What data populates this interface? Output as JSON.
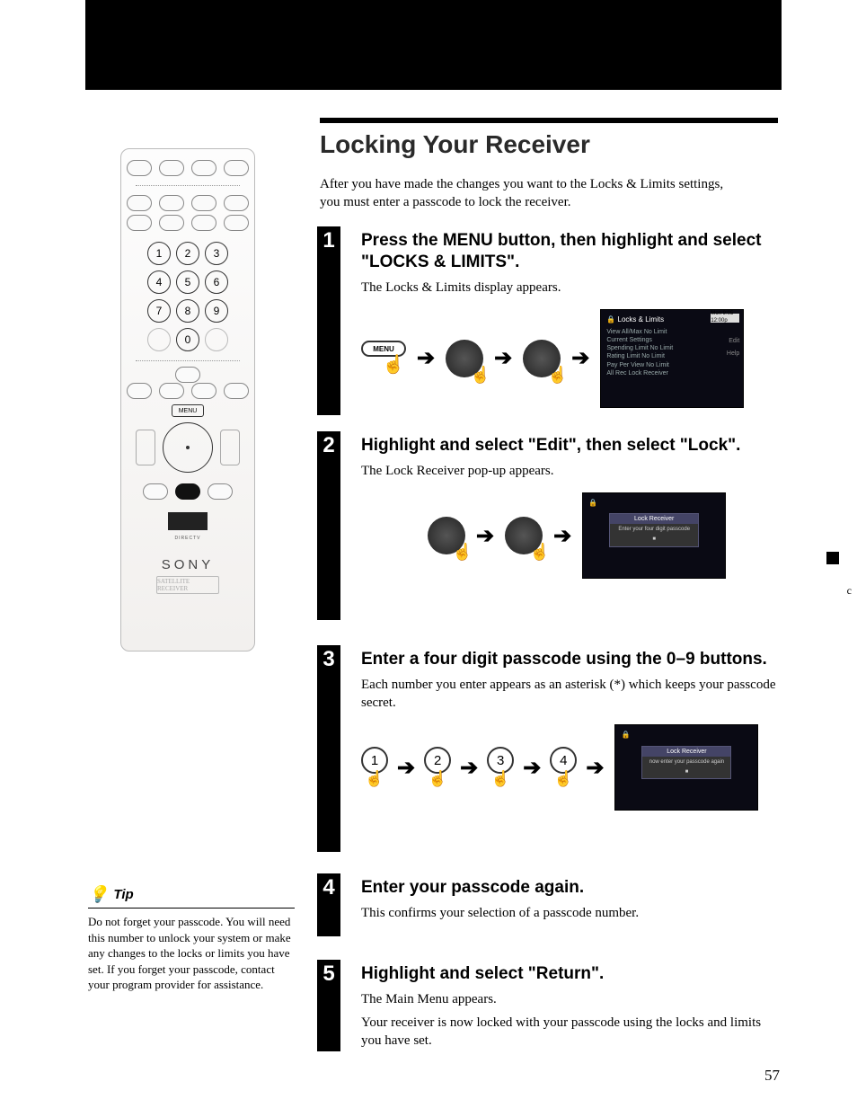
{
  "banner": {},
  "heading": "Locking Your Receiver",
  "intro": "After you have made the changes you want to the Locks & Limits settings, you must enter a passcode to lock the receiver.",
  "remote": {
    "numpad": [
      "1",
      "2",
      "3",
      "4",
      "5",
      "6",
      "7",
      "8",
      "9",
      "",
      "0",
      ""
    ],
    "menu_label": "MENU",
    "brand": "SONY",
    "directv_label": "DIRECTV",
    "sub_label": "SATELLITE RECEIVER"
  },
  "steps": [
    {
      "num": "1",
      "title": "Press the MENU button, then highlight and select \"LOCKS & LIMITS\".",
      "body": "The Locks & Limits display appears.",
      "menu_label": "MENU",
      "screen": {
        "hdr": "Locks & Limits",
        "date": "Mon 9:05 12:00p",
        "lines": [
          "View All/Max  No Limit",
          "Current Settings",
          "  Spending Limit  No Limit",
          "  Rating Limit   No Limit",
          "  Pay Per View   No Limit",
          "  All Rec Lock   Receiver"
        ],
        "opt1": "Edit",
        "opt2": "Help"
      }
    },
    {
      "num": "2",
      "title": "Highlight and select \"Edit\", then select \"Lock\".",
      "body": "The Lock Receiver pop-up appears.",
      "screen": {
        "popup_title": "Lock Receiver",
        "popup_body": "Enter your four digit passcode"
      }
    },
    {
      "num": "3",
      "title": "Enter a four digit passcode using the 0–9 buttons.",
      "body": "Each number you enter appears as an asterisk (*) which keeps your passcode secret.",
      "digits": [
        "1",
        "2",
        "3",
        "4"
      ],
      "screen": {
        "popup_title": "Lock Receiver",
        "popup_body": "now enter your passcode again"
      }
    },
    {
      "num": "4",
      "title": "Enter your passcode again.",
      "body": "This confirms your selection of a passcode number."
    },
    {
      "num": "5",
      "title": "Highlight and select \"Return\".",
      "body": "The Main Menu appears.",
      "body2": "Your receiver is now locked with your passcode using the locks and limits you have set."
    }
  ],
  "tip": {
    "label": "Tip",
    "text": "Do not forget your passcode. You will need this number to unlock your system or make any changes to the locks or limits you have set. If you forget your passcode, contact your program provider for assistance."
  },
  "page_number": "57",
  "side_letter": "c"
}
